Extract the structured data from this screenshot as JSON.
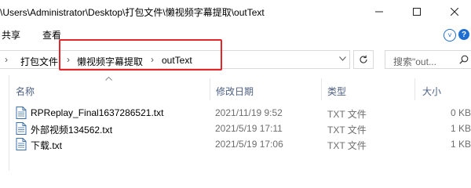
{
  "window": {
    "title": "\\Users\\Administrator\\Desktop\\打包文件\\懒视频字幕提取\\outText"
  },
  "ribbon": {
    "tabs": [
      {
        "label": "共享"
      },
      {
        "label": "查看"
      }
    ]
  },
  "address": {
    "crumbs": [
      {
        "label": "打包文件"
      },
      {
        "label": "懒视频字幕提取"
      },
      {
        "label": "outText"
      }
    ],
    "separator": "›"
  },
  "search": {
    "placeholder": "搜索\"out..."
  },
  "columns": {
    "name": "名称",
    "date": "修改日期",
    "type": "类型",
    "size": "大小"
  },
  "files": [
    {
      "name": "RPReplay_Final1637286521.txt",
      "date": "2021/11/19 9:52",
      "type": "TXT 文件",
      "size": "0 KB"
    },
    {
      "name": "外部视频134562.txt",
      "date": "2021/5/19 17:11",
      "type": "TXT 文件",
      "size": "1 KB"
    },
    {
      "name": "下载.txt",
      "date": "2021/5/19 17:06",
      "type": "TXT 文件",
      "size": "1 KB"
    }
  ],
  "colors": {
    "highlight": "#e8242b",
    "header_text": "#4d6082",
    "accent": "#1e6fd1"
  },
  "icons": {
    "file": "text-file-icon",
    "refresh": "refresh-icon",
    "search": "search-icon"
  }
}
